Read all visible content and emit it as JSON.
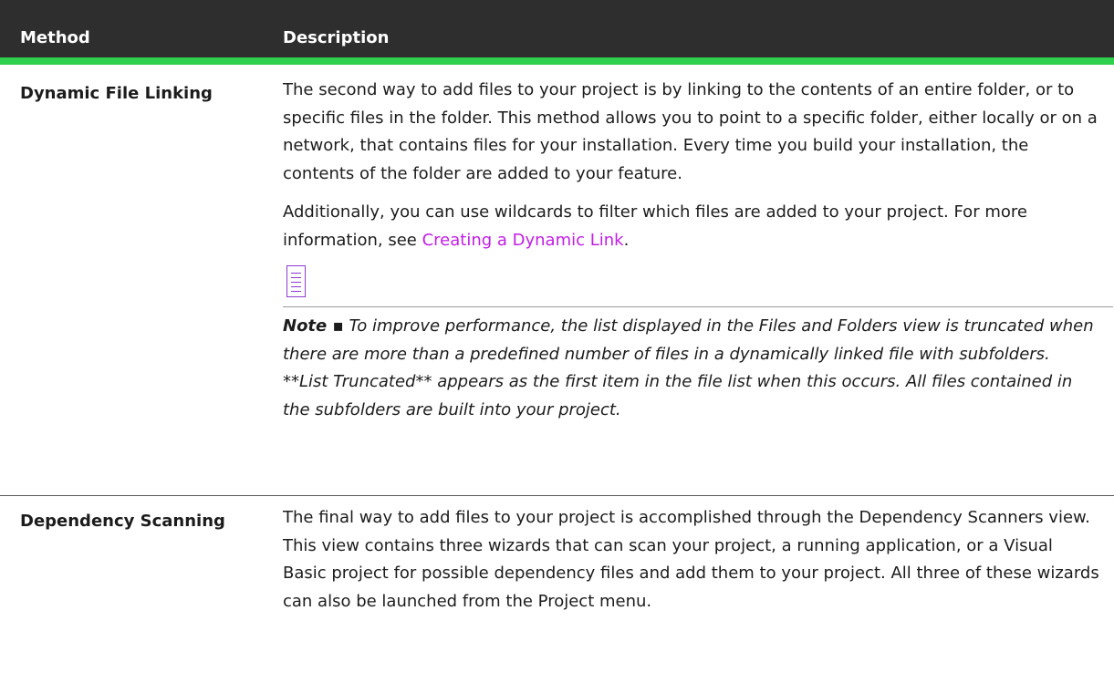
{
  "header": {
    "method": "Method",
    "description": "Description"
  },
  "rows": [
    {
      "method": "Dynamic File Linking",
      "paragraph1": "The second way to add files to your project is by linking to the contents of an entire folder, or to specific files in the folder. This method allows you to point to a specific folder, either locally or on a network, that contains files for your installation. Every time you build your installation, the contents of the folder are added to your feature.",
      "paragraph2_prefix": "Additionally, you can use wildcards to filter which files are added to your project. For more information, see ",
      "link_text": "Creating a Dynamic Link",
      "paragraph2_suffix": ".",
      "note_label": "Note ▪",
      "note_text": " To improve performance, the list displayed in the Files and Folders view is truncated when there are more than a predefined number of files in a dynamically linked file with subfolders. **List Truncated** appears as the first item in the file list when this occurs. All files contained in the subfolders are built into your project.",
      "note_icon": "note-icon"
    },
    {
      "method": "Dependency Scanning",
      "paragraph1": "The final way to add files to your project is accomplished through the Dependency Scanners view. This view contains three wizards that can scan your project, a running application, or a Visual Basic project for possible dependency files and add them to your project. All three of these wizards can also be launched from the Project menu."
    }
  ],
  "colors": {
    "header_bg": "#2e2e2e",
    "header_accent": "#2fcf4e",
    "link": "#c21ee6",
    "note_icon": "#8c3bd1"
  }
}
